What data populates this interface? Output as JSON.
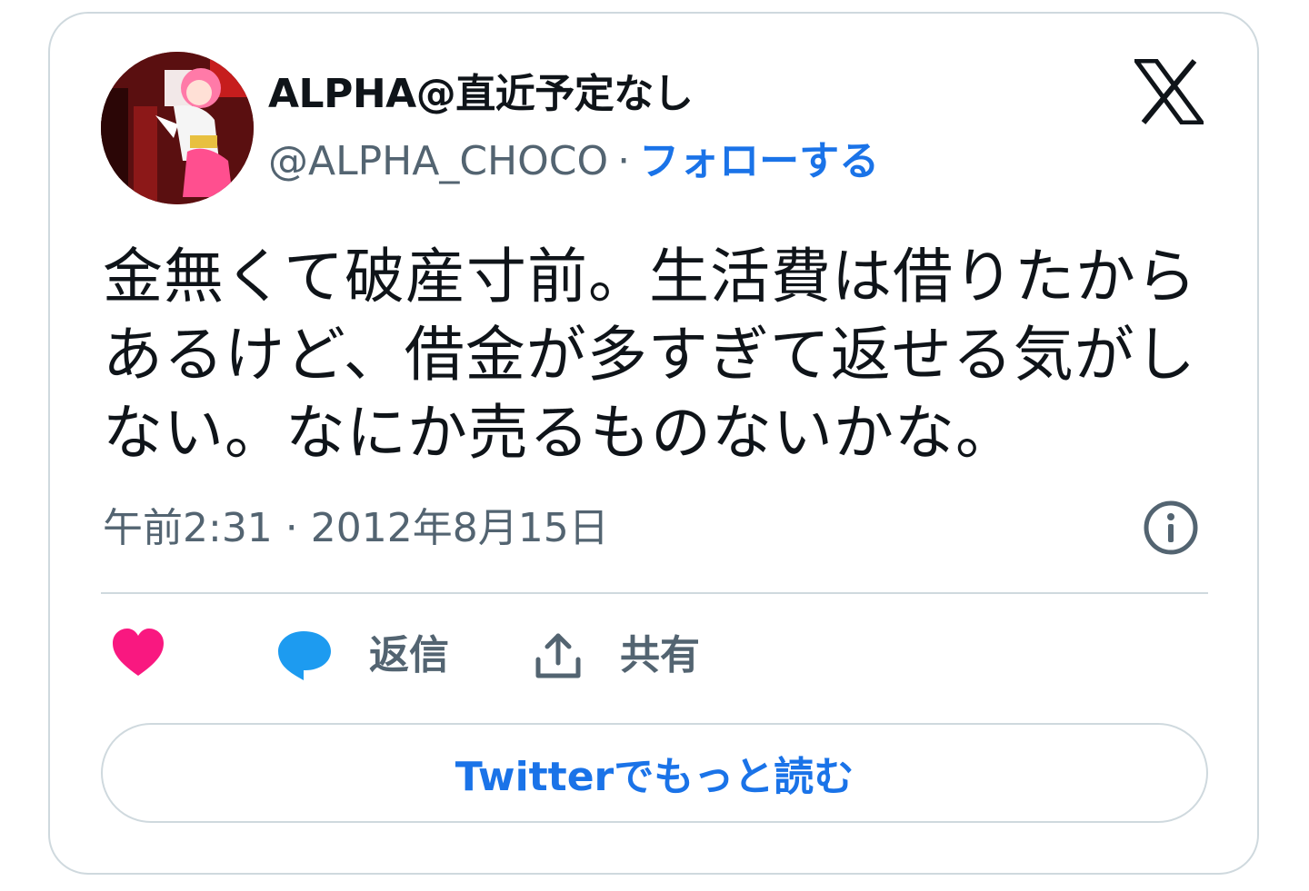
{
  "author": {
    "display_name": "ALPHA@直近予定なし",
    "handle": "@ALPHA_CHOCO",
    "separator": "·",
    "follow_label": "フォローする"
  },
  "tweet": {
    "text": "金無くて破産寸前。生活費は借りたからあるけど、借金が多すぎて返せる気がしない。なにか売るものないかな。",
    "timestamp": "午前2:31 · 2012年8月15日"
  },
  "actions": {
    "like_icon": "heart-icon",
    "reply_label": "返信",
    "share_label": "共有"
  },
  "read_more_label": "Twitterでもっと読む",
  "colors": {
    "accent": "#1a73e8",
    "like": "#f91880",
    "reply": "#1d9bf0",
    "muted": "#536471",
    "border": "#cfd9de"
  }
}
